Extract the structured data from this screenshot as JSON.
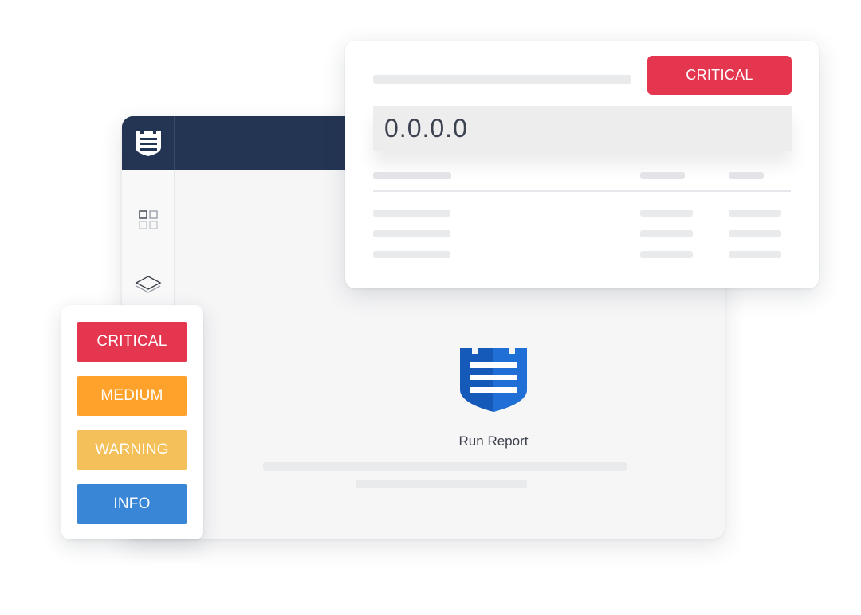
{
  "app": {
    "main_title": "Run Report",
    "sidebar_icons": [
      "grid-icon",
      "layers-icon"
    ]
  },
  "detail_card": {
    "severity_label": "CRITICAL",
    "ip_value": "0.0.0.0"
  },
  "severity_legend": {
    "items": [
      {
        "label": "CRITICAL",
        "color": "#e5364f"
      },
      {
        "label": "MEDIUM",
        "color": "#ffa22b"
      },
      {
        "label": "WARNING",
        "color": "#f3c05a"
      },
      {
        "label": "INFO",
        "color": "#3a86d6"
      }
    ]
  },
  "colors": {
    "header_navy": "#243553",
    "brand_blue": "#1559b9",
    "critical": "#e5364f"
  }
}
